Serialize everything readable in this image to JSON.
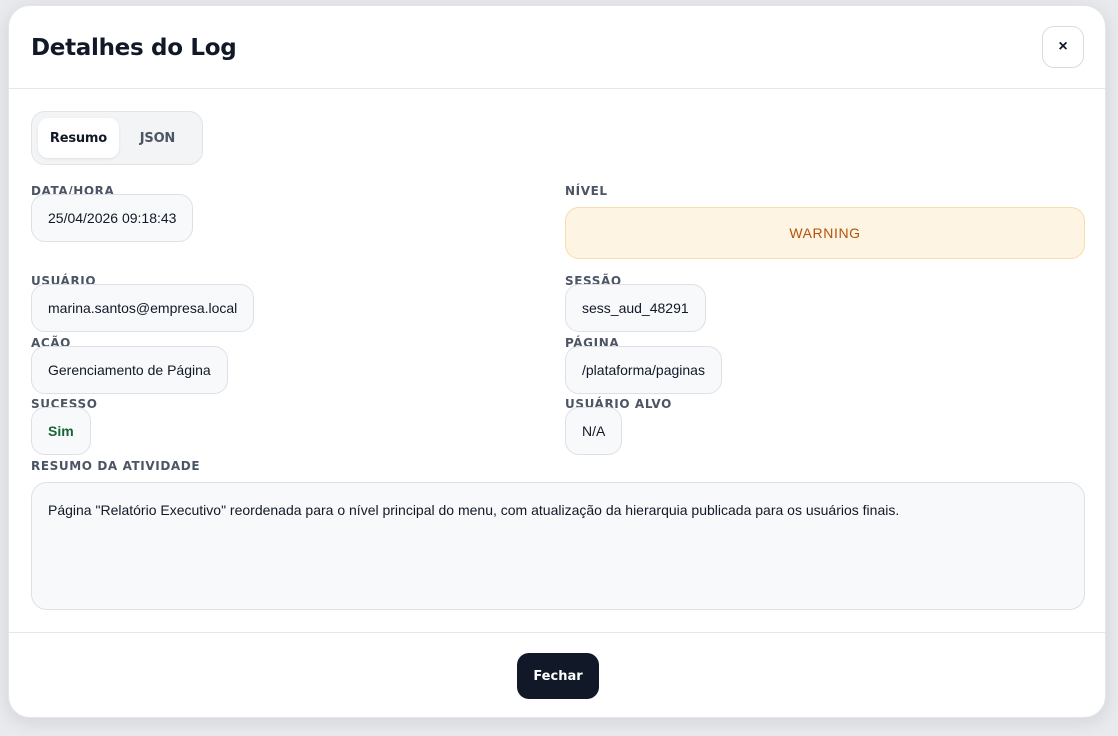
{
  "modal": {
    "title": "Detalhes do Log",
    "close_icon": "×",
    "footer_button": "Fechar"
  },
  "tabs": [
    {
      "label": "Resumo",
      "active": true
    },
    {
      "label": "JSON",
      "active": false
    }
  ],
  "fields": {
    "datetime": {
      "label": "Data/Hora",
      "value": "25/04/2026 09:18:43"
    },
    "level": {
      "label": "Nível",
      "value": "WARNING"
    },
    "user": {
      "label": "Usuário",
      "value": "marina.santos@empresa.local"
    },
    "session": {
      "label": "Sessão",
      "value": "sess_aud_48291"
    },
    "action": {
      "label": "Ação",
      "value": "Gerenciamento de Página"
    },
    "page": {
      "label": "Página",
      "value": "/plataforma/paginas"
    },
    "success": {
      "label": "Sucesso",
      "value": "Sim"
    },
    "target_user": {
      "label": "Usuário Alvo",
      "value": "N/A"
    },
    "activity_summary": {
      "label": "Resumo da Atividade",
      "value": "Página \"Relatório Executivo\" reordenada para o nível principal do menu, com atualização da hierarquia publicada para os usuários finais."
    }
  },
  "colors": {
    "warning_text": "#b45309",
    "warning_bg": "#fef4e4",
    "success_text": "#166534",
    "primary_button": "#111827"
  }
}
